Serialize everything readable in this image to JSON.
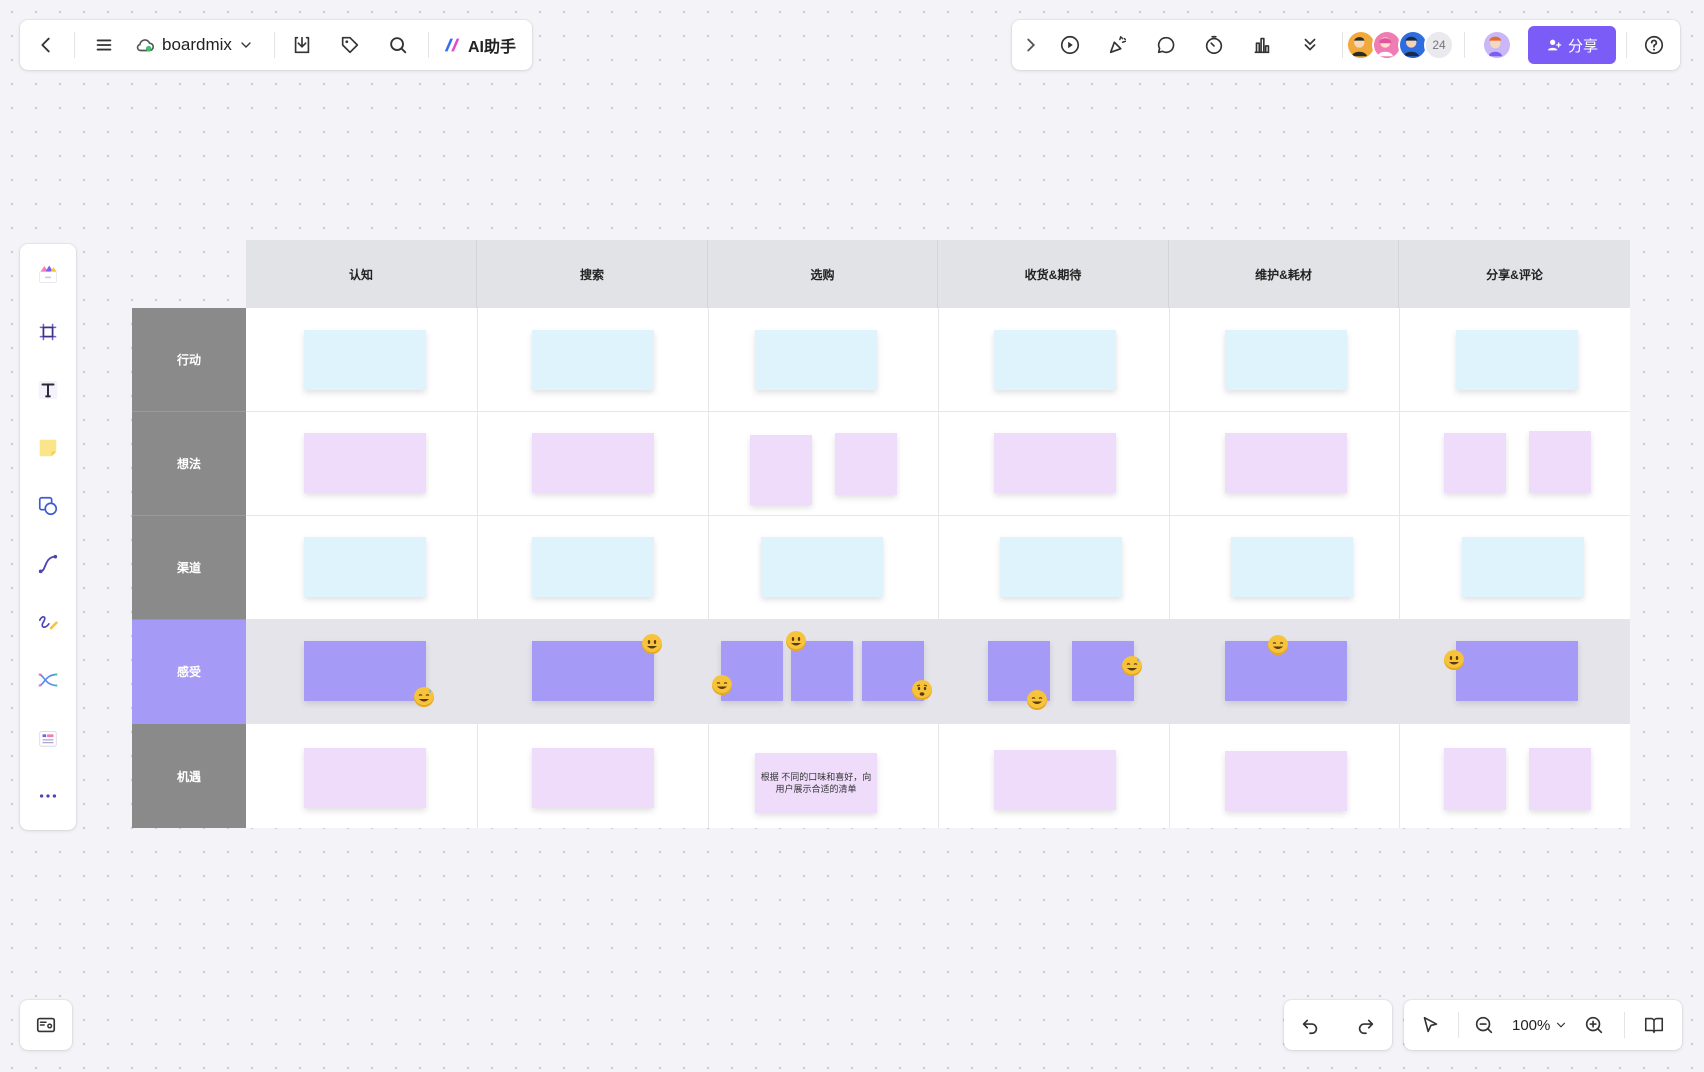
{
  "app": {
    "name": "boardmix",
    "ai_label": "AI助手"
  },
  "collaborators": {
    "count": "24"
  },
  "share": {
    "label": "分享"
  },
  "zoom": {
    "level": "100%"
  },
  "table": {
    "columns": [
      "认知",
      "搜索",
      "选购",
      "收货&期待",
      "维护&耗材",
      "分享&评论"
    ],
    "rows": [
      {
        "label": "行动",
        "highlight": false
      },
      {
        "label": "想法",
        "highlight": false
      },
      {
        "label": "渠道",
        "highlight": false
      },
      {
        "label": "感受",
        "highlight": true
      },
      {
        "label": "机遇",
        "highlight": false
      }
    ],
    "readable_note": "根据 不同的口味和喜好，向用户展示合适的清单"
  },
  "colors": {
    "row_label_gray": "#8a8a8a",
    "row_label_purple": "#a59af5",
    "note_blue": "#def3fc",
    "note_lilac": "#efdcfb",
    "note_purple": "#a59af5",
    "accent": "#7b5cf6"
  },
  "icons": {
    "top_left": [
      "back-icon",
      "menu-icon",
      "cloud-icon",
      "chevron-down-icon",
      "download-icon",
      "tag-icon",
      "search-icon",
      "ai-logo-icon"
    ],
    "top_right": [
      "chevron-right-icon",
      "play-icon",
      "celebrate-icon",
      "comment-icon",
      "timer-icon",
      "vote-icon",
      "chevron-double-down-icon",
      "help-icon"
    ],
    "left_toolbar": [
      "templates-icon",
      "frame-icon",
      "text-icon",
      "sticky-note-icon",
      "shape-icon",
      "connector-icon",
      "pen-icon",
      "mindmap-icon",
      "table-icon",
      "more-icon"
    ],
    "bottom": [
      "minimap-icon",
      "undo-icon",
      "redo-icon",
      "select-icon",
      "zoom-out-icon",
      "zoom-in-icon",
      "book-icon"
    ]
  }
}
